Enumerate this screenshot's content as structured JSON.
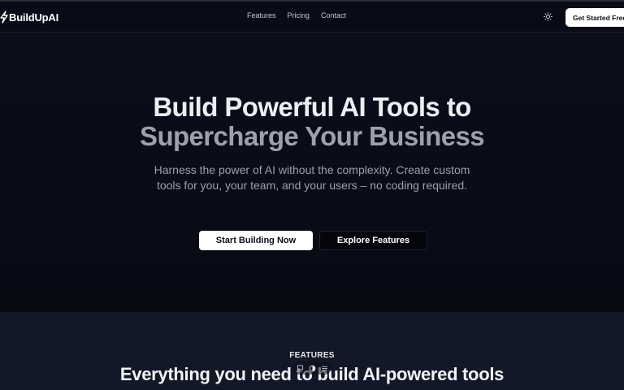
{
  "brand": {
    "name": "BuildUpAI",
    "icon": "lightning-bolt-icon"
  },
  "nav": {
    "links": [
      {
        "label": "Features"
      },
      {
        "label": "Pricing"
      },
      {
        "label": "Contact"
      }
    ],
    "theme_icon": "sun-icon",
    "cta_label": "Get Started Free"
  },
  "hero": {
    "title_line1": "Build Powerful AI Tools to",
    "title_line2": "Supercharge Your Business",
    "subtitle": "Harness the power of AI without the complexity. Create custom tools for you, your team, and your users – no coding required.",
    "primary_button": "Start Building Now",
    "secondary_button": "Explore Features"
  },
  "features": {
    "eyebrow": "FEATURES",
    "title": "Everything you need to build AI-powered tools"
  },
  "floating_toolbar": {
    "icons": [
      "chat-bubble-icon",
      "contrast-icon",
      "menu-icon"
    ]
  },
  "colors": {
    "background": "#090b16",
    "features_background": "#131828",
    "primary_button": "#ffffff",
    "muted_text": "#9da0ab"
  }
}
